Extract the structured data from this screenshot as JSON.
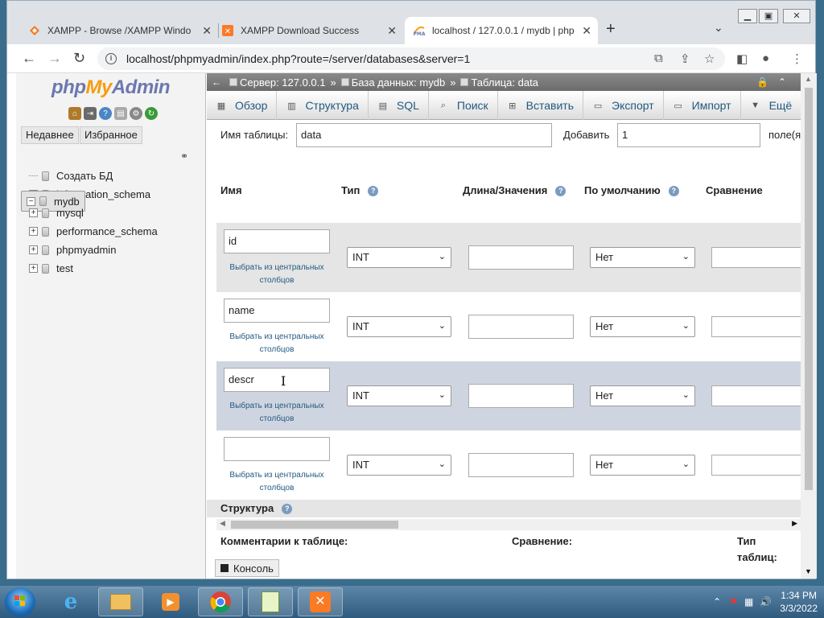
{
  "browser": {
    "tabs": [
      {
        "title": "XAMPP - Browse /XAMPP Windo",
        "icon": "xampp-orange-icon"
      },
      {
        "title": "XAMPP Download Success",
        "icon": "xampp-icon"
      },
      {
        "title": "localhost / 127.0.0.1 / mydb | php",
        "icon": "phpmyadmin-icon",
        "active": true
      }
    ],
    "url": "localhost/phpmyadmin/index.php?route=/server/databases&server=1"
  },
  "nav": {
    "logo": {
      "php": "php",
      "my": "My",
      "admin": "Admin"
    },
    "recent_label": "Недавнее",
    "favorites_label": "Избранное",
    "tree": [
      {
        "label": "Создать БД",
        "type": "new"
      },
      {
        "label": "information_schema"
      },
      {
        "label": "mydb",
        "selected": true
      },
      {
        "label": "mysql"
      },
      {
        "label": "performance_schema"
      },
      {
        "label": "phpmyadmin"
      },
      {
        "label": "test"
      }
    ]
  },
  "breadcrumb": {
    "server": "Сервер: 127.0.0.1",
    "database": "База данных: mydb",
    "table": "Таблица: data"
  },
  "menu": [
    {
      "label": "Обзор",
      "icon": "browse-icon"
    },
    {
      "label": "Структура",
      "icon": "structure-icon"
    },
    {
      "label": "SQL",
      "icon": "sql-icon"
    },
    {
      "label": "Поиск",
      "icon": "search-icon"
    },
    {
      "label": "Вставить",
      "icon": "insert-icon"
    },
    {
      "label": "Экспорт",
      "icon": "export-icon"
    },
    {
      "label": "Импорт",
      "icon": "import-icon"
    },
    {
      "label": "Ещё",
      "icon": "chevron-down-icon"
    }
  ],
  "form": {
    "table_name_label": "Имя таблицы:",
    "table_name_value": "data",
    "add_label": "Добавить",
    "add_value": "1",
    "fields_label": "поле(я)",
    "headers": {
      "name": "Имя",
      "type": "Тип",
      "length": "Длина/Значения",
      "default": "По умолчанию",
      "collation": "Сравнение"
    },
    "central_columns_link": [
      "Выбрать из центральных",
      "столбцов"
    ],
    "rows": [
      {
        "name": "id",
        "type": "INT",
        "default": "Нет"
      },
      {
        "name": "name",
        "type": "INT",
        "default": "Нет"
      },
      {
        "name": "descr",
        "type": "INT",
        "default": "Нет"
      },
      {
        "name": "",
        "type": "INT",
        "default": "Нет"
      }
    ],
    "structure_label": "Структура",
    "table_comments_label": "Комментарии к таблице:",
    "collation_label": "Сравнение:",
    "table_type_label_1": "Тип",
    "table_type_label_2": "таблиц:",
    "console_label": "Консоль"
  },
  "taskbar": {
    "time": "1:34 PM",
    "date": "3/3/2022"
  }
}
